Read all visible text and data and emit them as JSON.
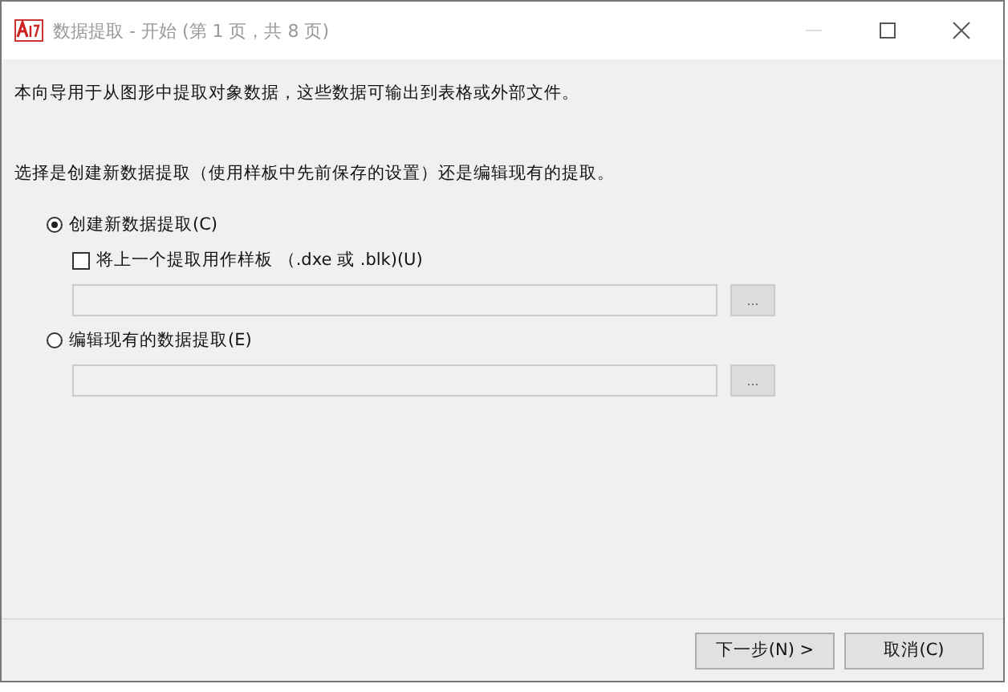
{
  "window": {
    "title": "数据提取 - 开始 (第 1 页，共 8 页)"
  },
  "intro": "本向导用于从图形中提取对象数据，这些数据可输出到表格或外部文件。",
  "prompt": "选择是创建新数据提取（使用样板中先前保存的设置）还是编辑现有的提取。",
  "options": [
    {
      "kind": "radio",
      "label": "创建新数据提取(C)",
      "selected": true
    },
    {
      "kind": "checkbox",
      "label": "将上一个提取用作样板 （.dxe 或 .blk)(U)",
      "checked": false
    },
    {
      "kind": "path",
      "disabled": true,
      "browse": "..."
    },
    {
      "kind": "radio",
      "label": "编辑现有的数据提取(E)",
      "selected": false
    },
    {
      "kind": "path",
      "disabled": true,
      "browse": "..."
    }
  ],
  "buttons": [
    {
      "label": "下一步(N) >"
    },
    {
      "label": "取消(C)"
    }
  ]
}
